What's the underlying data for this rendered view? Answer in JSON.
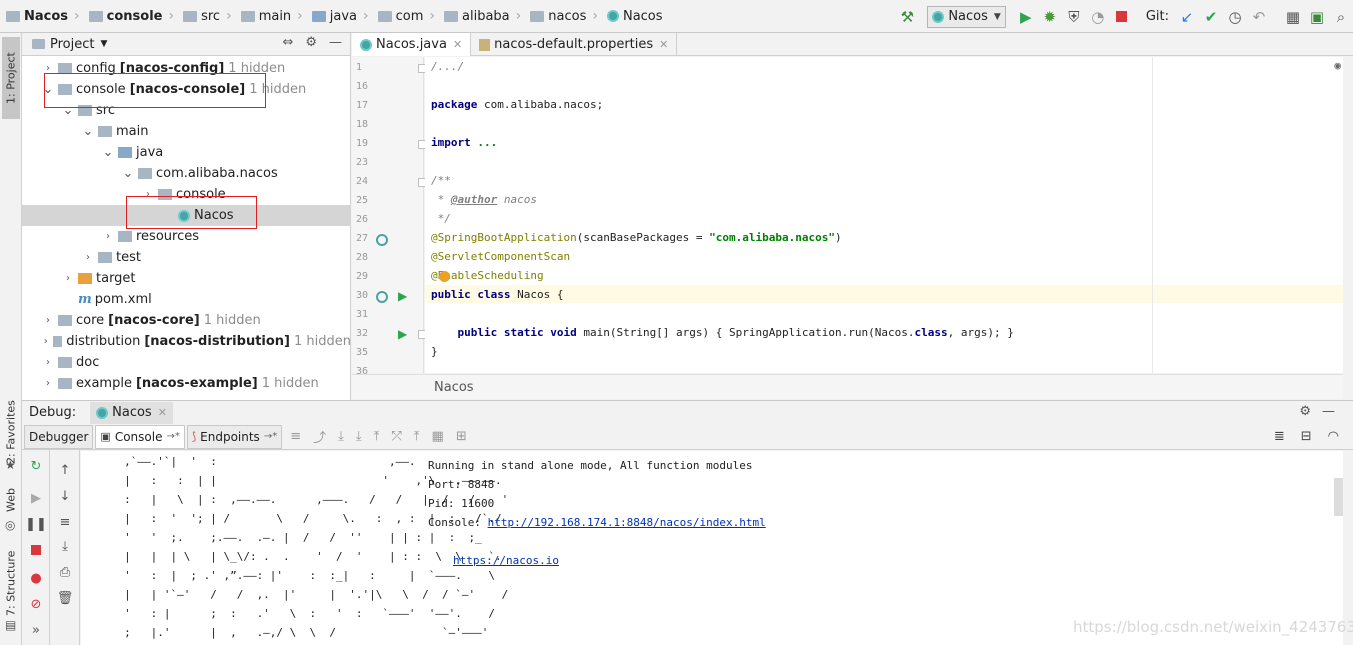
{
  "navbar": {
    "breadcrumbs": [
      {
        "label": "Nacos",
        "bold": true
      },
      {
        "label": "console",
        "bold": true
      },
      {
        "label": "src",
        "bold": false
      },
      {
        "label": "main",
        "bold": false
      },
      {
        "label": "java",
        "bold": false
      },
      {
        "label": "com",
        "bold": false
      },
      {
        "label": "alibaba",
        "bold": false
      },
      {
        "label": "nacos",
        "bold": false
      },
      {
        "label": "Nacos",
        "bold": false
      }
    ],
    "run_config": "Nacos",
    "git_label": "Git:"
  },
  "left_strip": {
    "project_tab": "1: Project",
    "favorites_tab": "2: Favorites",
    "web_tab": "Web",
    "structure_tab": "7: Structure"
  },
  "project_panel": {
    "title": "Project",
    "tree": [
      {
        "name": "config",
        "module": "[nacos-config]",
        "hidden": "1 hidden",
        "depth": 0,
        "expanded": false,
        "type": "module"
      },
      {
        "name": "console",
        "module": "[nacos-console]",
        "hidden": "1 hidden",
        "depth": 0,
        "expanded": true,
        "type": "module"
      },
      {
        "name": "src",
        "module": "",
        "hidden": "",
        "depth": 1,
        "expanded": true,
        "type": "folder"
      },
      {
        "name": "main",
        "module": "",
        "hidden": "",
        "depth": 2,
        "expanded": true,
        "type": "folder"
      },
      {
        "name": "java",
        "module": "",
        "hidden": "",
        "depth": 3,
        "expanded": true,
        "type": "source"
      },
      {
        "name": "com.alibaba.nacos",
        "module": "",
        "hidden": "",
        "depth": 4,
        "expanded": true,
        "type": "package"
      },
      {
        "name": "console",
        "module": "",
        "hidden": "",
        "depth": 5,
        "expanded": false,
        "type": "package"
      },
      {
        "name": "Nacos",
        "module": "",
        "hidden": "",
        "depth": 6,
        "expanded": null,
        "type": "class"
      },
      {
        "name": "resources",
        "module": "",
        "hidden": "",
        "depth": 3,
        "expanded": false,
        "type": "resources"
      },
      {
        "name": "test",
        "module": "",
        "hidden": "",
        "depth": 2,
        "expanded": false,
        "type": "folder"
      },
      {
        "name": "target",
        "module": "",
        "hidden": "",
        "depth": 1,
        "expanded": false,
        "type": "target"
      },
      {
        "name": "pom.xml",
        "module": "",
        "hidden": "",
        "depth": 1,
        "expanded": null,
        "type": "maven"
      },
      {
        "name": "core",
        "module": "[nacos-core]",
        "hidden": "1 hidden",
        "depth": 0,
        "expanded": false,
        "type": "module"
      },
      {
        "name": "distribution",
        "module": "[nacos-distribution]",
        "hidden": "1 hidden",
        "depth": 0,
        "expanded": false,
        "type": "module"
      },
      {
        "name": "doc",
        "module": "",
        "hidden": "",
        "depth": 0,
        "expanded": false,
        "type": "module"
      },
      {
        "name": "example",
        "module": "[nacos-example]",
        "hidden": "1 hidden",
        "depth": 0,
        "expanded": false,
        "type": "module"
      }
    ]
  },
  "editor": {
    "tabs": [
      {
        "label": "Nacos.java",
        "active": true
      },
      {
        "label": "nacos-default.properties",
        "active": false
      }
    ],
    "lines": [
      {
        "no": "1",
        "html": "<span class=\"cm\">/.../</span>"
      },
      {
        "no": "16",
        "html": ""
      },
      {
        "no": "17",
        "html": "<span class=\"kw\">package</span> com.alibaba.nacos;"
      },
      {
        "no": "18",
        "html": ""
      },
      {
        "no": "19",
        "html": "<span class=\"kw\">import</span> <span class=\"str\">...</span>"
      },
      {
        "no": "23",
        "html": ""
      },
      {
        "no": "24",
        "html": "<span class=\"cm\">/**</span>"
      },
      {
        "no": "25",
        "html": "<span class=\"cm\"> * </span><span class=\"cmtag\">@author</span><span class=\"cm\"> nacos</span>"
      },
      {
        "no": "26",
        "html": "<span class=\"cm\"> */</span>"
      },
      {
        "no": "27",
        "html": "<span class=\"ann\">@SpringBootApplication</span>(scanBasePackages = <span class=\"str\">\"com.alibaba.nacos\"</span>)"
      },
      {
        "no": "28",
        "html": "<span class=\"ann\">@ServletComponentScan</span>"
      },
      {
        "no": "29",
        "html": "<span class=\"ann\">@EnableScheduling</span>"
      },
      {
        "no": "30",
        "html": "<span class=\"kw\">public class</span> Nacos {"
      },
      {
        "no": "31",
        "html": ""
      },
      {
        "no": "32",
        "html": "    <span class=\"kw\">public static void</span> main(String[] args) { SpringApplication.run(Nacos.<span class=\"kw\">class</span>, args); }"
      },
      {
        "no": "35",
        "html": "}"
      },
      {
        "no": "36",
        "html": ""
      }
    ],
    "breadcrumb": "Nacos"
  },
  "debug": {
    "label": "Debug:",
    "session": "Nacos",
    "tabs": [
      {
        "label": "Debugger",
        "active": false
      },
      {
        "label": "Console",
        "active": true
      },
      {
        "label": "Endpoints",
        "active": false
      }
    ],
    "ascii_lines": [
      "     ,`——.'`|  '  :                          ,——.",
      "     |   :   :  | |                         '    ,'\\   ,——.——.",
      "     :   |   \\  | :  ,——.——.      ,———.   /   /   |  /   /    '",
      "     |   :  '  '; | /       \\   /     \\.   :  , :  |  :   /`./",
      "     '   '  ;.    ;.——.  .—. |  /   /  ''    | | : |  :  ;_",
      "     |   |  | \\   | \\_\\/: .  .    '  /  '    | : :  \\  \\    `.",
      "     '   :  |  ; .' ,”.——: |'    :  :_|   :     |  `———.    \\",
      "     |   | '`—'   /   /  ,.  |'     |  '.'|\\   \\  /  / `—'    /",
      "     '   : |      ;  :   .'   \\  :   '  :   `———'  '——'.    /",
      "     ;   |.'      |  ,   .—,/ \\  \\  /                `—'———'"
    ],
    "info": {
      "mode": "Running in stand alone mode, All function modules",
      "port": "Port: 8848",
      "pid": "Pid: 11600",
      "console_label": "Console: ",
      "console_url": "http://192.168.174.1:8848/nacos/index.html",
      "site_url": "https://nacos.io"
    }
  },
  "watermark": "https://blog.csdn.net/weixin_42437633",
  "colors": {
    "run": "#2ea44f",
    "stop": "#d9363e",
    "keyword": "#000080",
    "annotation": "#808000",
    "string": "#008000",
    "link": "#0033b3",
    "selection_box": "#e02020"
  }
}
